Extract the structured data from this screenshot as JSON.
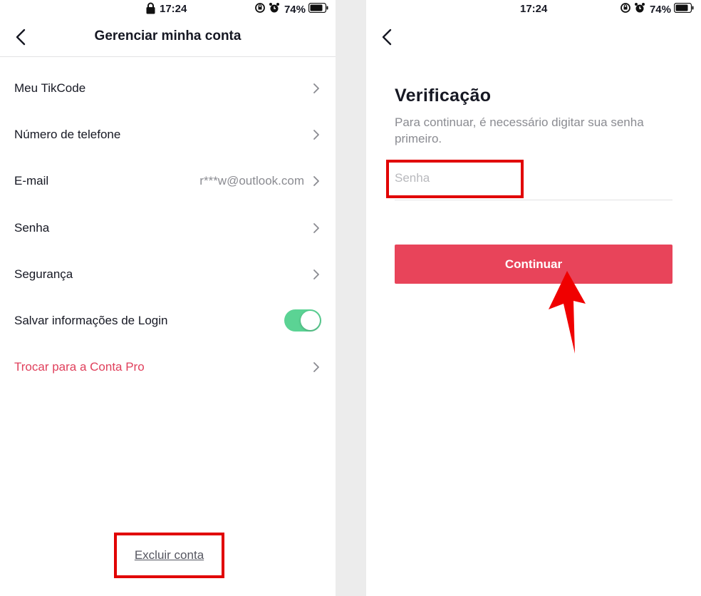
{
  "left": {
    "status": {
      "time": "17:24",
      "battery": "74%"
    },
    "title": "Gerenciar minha conta",
    "items": [
      {
        "label": "Meu TikCode"
      },
      {
        "label": "Número de telefone"
      },
      {
        "label": "E-mail",
        "value": "r***w@outlook.com"
      },
      {
        "label": "Senha"
      },
      {
        "label": "Segurança"
      },
      {
        "label": "Salvar informações de Login",
        "toggle": true
      },
      {
        "label": "Trocar para a Conta Pro"
      }
    ],
    "delete_label": "Excluir conta"
  },
  "right": {
    "status": {
      "time": "17:24",
      "battery": "74%"
    },
    "title": "Verificação",
    "subtitle": "Para continuar, é necessário digitar sua senha primeiro.",
    "password_placeholder": "Senha",
    "continue_label": "Continuar"
  },
  "colors": {
    "accent": "#e8445a",
    "pro_text": "#e0405c",
    "toggle_on": "#5bd394",
    "highlight": "#e10000"
  },
  "icons": [
    "lock-icon",
    "rotation-lock-icon",
    "alarm-icon",
    "battery-icon",
    "back-chevron-icon",
    "chevron-right-icon",
    "arrow-pointer-icon"
  ]
}
